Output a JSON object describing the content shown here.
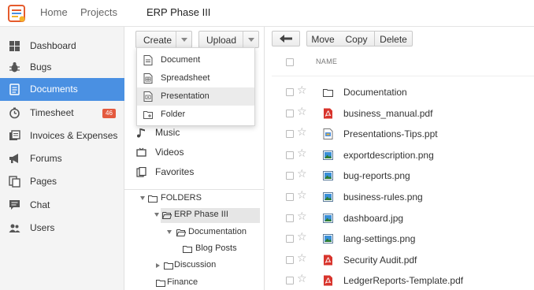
{
  "topbar": {
    "logo_icon": "app-logo-icon",
    "nav": [
      {
        "label": "Home"
      },
      {
        "label": "Projects"
      }
    ],
    "project_name": "ERP Phase III"
  },
  "sidebar": {
    "accent": "#4a90e2",
    "badge_color": "#e45a3f",
    "items": [
      {
        "label": "Dashboard",
        "icon": "dashboard-icon"
      },
      {
        "label": "Bugs",
        "icon": "bug-icon"
      },
      {
        "label": "Documents",
        "icon": "documents-icon",
        "active": true
      },
      {
        "label": "Timesheet",
        "icon": "clock-icon",
        "badge": "46"
      },
      {
        "label": "Invoices & Expenses",
        "icon": "invoice-icon"
      },
      {
        "label": "Forums",
        "icon": "megaphone-icon"
      },
      {
        "label": "Pages",
        "icon": "pages-icon"
      },
      {
        "label": "Chat",
        "icon": "chat-icon"
      },
      {
        "label": "Users",
        "icon": "users-icon"
      }
    ]
  },
  "toolbar": {
    "create_label": "Create",
    "upload_label": "Upload"
  },
  "create_menu": {
    "items": [
      {
        "label": "Document",
        "icon": "document-icon"
      },
      {
        "label": "Spreadsheet",
        "icon": "spreadsheet-icon"
      },
      {
        "label": "Presentation",
        "icon": "presentation-icon",
        "highlighted": true
      },
      {
        "label": "Folder",
        "icon": "folder-icon"
      }
    ]
  },
  "library": {
    "items": [
      {
        "label": "Music",
        "icon": "music-icon"
      },
      {
        "label": "Videos",
        "icon": "video-icon"
      },
      {
        "label": "Favorites",
        "icon": "favorites-icon"
      }
    ]
  },
  "tree": {
    "root": "FOLDERS",
    "nodes": [
      {
        "label": "ERP Phase III",
        "selected": true
      },
      {
        "label": "Documentation"
      },
      {
        "label": "Blog Posts"
      },
      {
        "label": "Discussion"
      },
      {
        "label": "Finance"
      }
    ]
  },
  "file_actions": {
    "back_icon": "arrow-left-icon",
    "move_label": "Move",
    "copy_label": "Copy",
    "delete_label": "Delete"
  },
  "file_list": {
    "header_name": "NAME",
    "files": [
      {
        "name": "Documentation",
        "icon": "folder-icon"
      },
      {
        "name": "business_manual.pdf",
        "icon": "pdf-icon"
      },
      {
        "name": "Presentations-Tips.ppt",
        "icon": "ppt-icon"
      },
      {
        "name": "exportdescription.png",
        "icon": "image-icon"
      },
      {
        "name": "bug-reports.png",
        "icon": "image-icon"
      },
      {
        "name": "business-rules.png",
        "icon": "image-icon"
      },
      {
        "name": "dashboard.jpg",
        "icon": "image-icon"
      },
      {
        "name": "lang-settings.png",
        "icon": "image-icon"
      },
      {
        "name": "Security Audit.pdf",
        "icon": "pdf-icon"
      },
      {
        "name": "LedgerReports-Template.pdf",
        "icon": "pdf-icon"
      }
    ]
  }
}
